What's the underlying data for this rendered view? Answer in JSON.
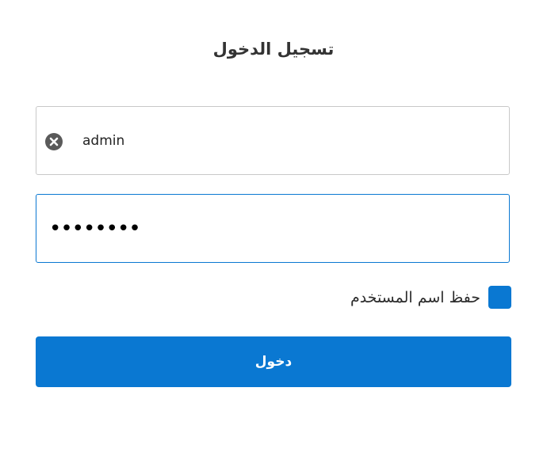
{
  "login": {
    "title": "تسجيل الدخول",
    "username_value": "admin",
    "password_mask": "••••••••",
    "remember_label": "حفظ اسم المستخدم",
    "remember_checked": true,
    "submit_label": "دخول"
  },
  "icons": {
    "clear": "close-circle-icon"
  },
  "colors": {
    "accent": "#0a78d2",
    "text": "#2b2b2b",
    "field_border": "#c8c8c8",
    "clear_icon": "#5a5a5a"
  }
}
